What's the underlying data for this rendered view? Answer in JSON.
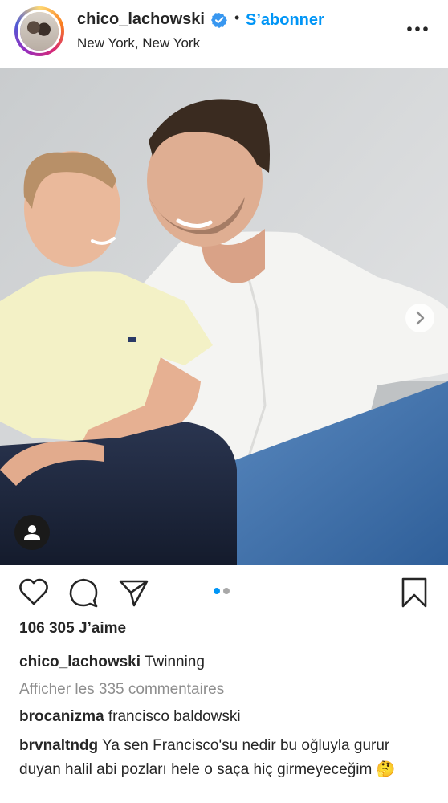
{
  "post": {
    "username": "chico_lachowski",
    "follow_label": "S’abonner",
    "separator": "•",
    "location": "New York, New York",
    "photo_description_icon": "person-icon",
    "pager": {
      "total": 2,
      "active": 1
    },
    "likes": "106 305 J’aime",
    "caption": {
      "username": "chico_lachowski",
      "text": "Twinning"
    },
    "view_comments": "Afficher les 335 commentaires",
    "comments": [
      {
        "username": "brocanizma",
        "text": "francisco baldowski"
      },
      {
        "username": "brvnaltndg",
        "text": "Ya sen Francisco'su nedir bu oğluyla gurur duyan halil abi pozları hele o saça hiç girmeyeceğim 🤔"
      }
    ]
  },
  "colors": {
    "accent": "#0095f6",
    "text": "#262626",
    "muted": "#8e8e8e",
    "pager_active": "#0095f6",
    "pager_inactive": "#a8a8a8"
  }
}
